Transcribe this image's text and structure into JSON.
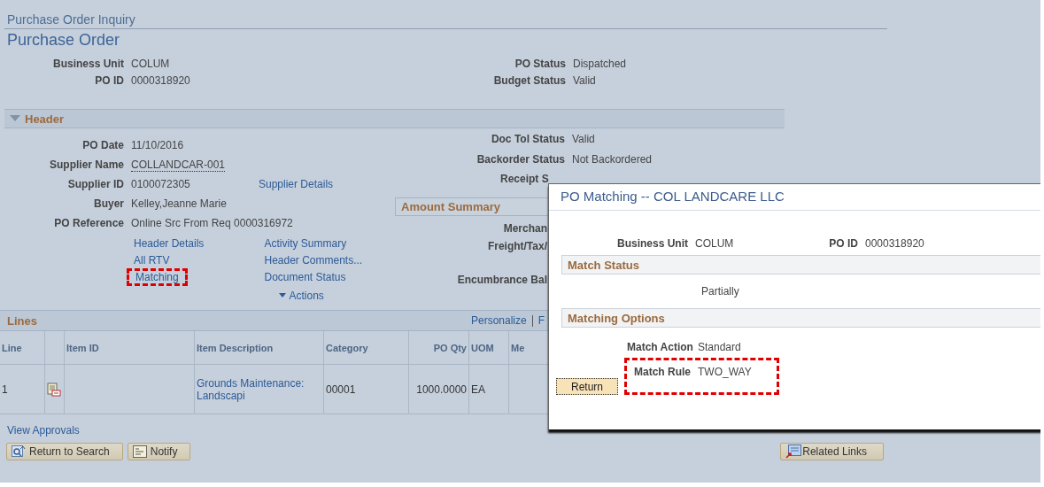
{
  "page": {
    "breadcrumb": "Purchase Order Inquiry",
    "title": "Purchase Order"
  },
  "summary_left": [
    {
      "label": "Business Unit",
      "value": "COLUM"
    },
    {
      "label": "PO ID",
      "value": "0000318920"
    }
  ],
  "summary_right": [
    {
      "label": "PO Status",
      "value": "Dispatched"
    },
    {
      "label": "Budget Status",
      "value": "Valid"
    }
  ],
  "header": {
    "title": "Header",
    "expanded": true,
    "fields_left": [
      {
        "label": "PO Date",
        "value": "11/10/2016",
        "kind": "text"
      },
      {
        "label": "Supplier Name",
        "value": "COLLANDCAR-001",
        "kind": "lookup"
      },
      {
        "label": "Supplier ID",
        "value": "0100072305",
        "kind": "text",
        "link": "Supplier Details"
      },
      {
        "label": "Buyer",
        "value": "Kelley,Jeanne Marie",
        "kind": "text"
      },
      {
        "label": "PO Reference",
        "value": "Online Src From Req 0000316972",
        "kind": "text"
      }
    ],
    "fields_right": [
      {
        "label": "Doc Tol Status",
        "value": "Valid"
      },
      {
        "label": "Backorder Status",
        "value": "Not Backordered"
      },
      {
        "label": "Receipt S"
      }
    ],
    "amount_summary": {
      "title": "Amount Summary",
      "labels": [
        "Merchan",
        "Freight/Tax/",
        "Encumbrance Bal"
      ]
    },
    "links_col1": [
      {
        "label": "Header Details",
        "highlighted": false
      },
      {
        "label": "All RTV",
        "highlighted": false
      },
      {
        "label": "Matching",
        "highlighted": true
      }
    ],
    "links_col2": [
      "Activity Summary",
      "Header Comments...",
      "Document Status"
    ],
    "actions": "Actions"
  },
  "lines": {
    "title": "Lines",
    "toolbar": [
      "Personalize",
      "F"
    ],
    "columns": [
      {
        "label": "Line",
        "kind": "text"
      },
      {
        "kind": "icon"
      },
      {
        "label": "Item ID",
        "kind": "text"
      },
      {
        "label": "Item Description",
        "kind": "link"
      },
      {
        "label": "Category",
        "kind": "text"
      },
      {
        "label": "PO Qty",
        "kind": "number"
      },
      {
        "label": "UOM",
        "kind": "text"
      },
      {
        "label": "Me",
        "kind": "text"
      }
    ],
    "rows": [
      {
        "cells": [
          "1",
          null,
          null,
          "Grounds Maintenance: Landscapi",
          "00001",
          "1000.0000",
          "EA",
          null
        ]
      }
    ]
  },
  "view_approvals": "View Approvals",
  "buttons": [
    {
      "label": "Return to Search",
      "kind": "search"
    },
    {
      "label": "Notify",
      "kind": "notify"
    }
  ],
  "related_links": "Related Links",
  "dialog": {
    "title": "PO Matching -- COL LANDCARE LLC",
    "fields": [
      {
        "label": "Business Unit",
        "value": "COLUM"
      },
      {
        "label": "PO ID",
        "value": "0000318920"
      }
    ],
    "match_status": {
      "title": "Match Status",
      "value": "Partially"
    },
    "matching_options": {
      "title": "Matching Options",
      "fields": [
        {
          "label": "Match Action",
          "value": "Standard",
          "highlighted": false
        },
        {
          "label": "Match Rule",
          "value": "TWO_WAY",
          "highlighted": true
        }
      ]
    },
    "return_button": "Return"
  }
}
